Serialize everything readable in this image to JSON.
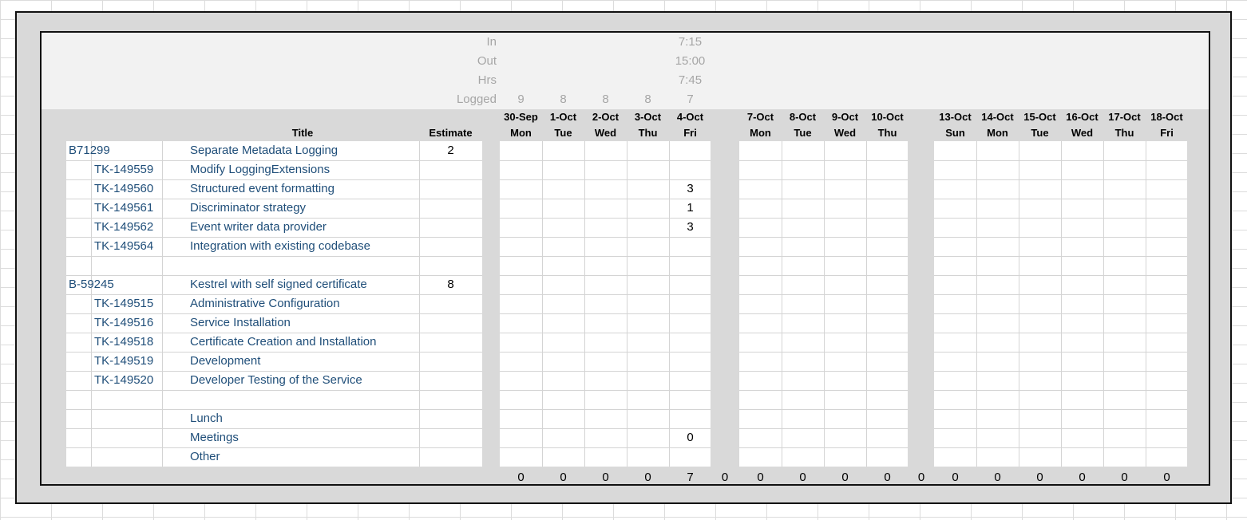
{
  "summary": {
    "labels": [
      "In",
      "Out",
      "Hrs",
      "Logged"
    ],
    "in": "7:15",
    "out": "15:00",
    "hrs": "7:45",
    "logged": [
      "9",
      "8",
      "8",
      "8",
      "7"
    ]
  },
  "headers": {
    "title": "Title",
    "estimate": "Estimate"
  },
  "weeks": [
    {
      "days": [
        {
          "date": "30-Sep",
          "dow": "Mon"
        },
        {
          "date": "1-Oct",
          "dow": "Tue"
        },
        {
          "date": "2-Oct",
          "dow": "Wed"
        },
        {
          "date": "3-Oct",
          "dow": "Thu"
        },
        {
          "date": "4-Oct",
          "dow": "Fri"
        }
      ]
    },
    {
      "days": [
        {
          "date": "7-Oct",
          "dow": "Mon"
        },
        {
          "date": "8-Oct",
          "dow": "Tue"
        },
        {
          "date": "9-Oct",
          "dow": "Wed"
        },
        {
          "date": "10-Oct",
          "dow": "Thu"
        }
      ]
    },
    {
      "days": [
        {
          "date": "13-Oct",
          "dow": "Sun"
        },
        {
          "date": "14-Oct",
          "dow": "Mon"
        },
        {
          "date": "15-Oct",
          "dow": "Tue"
        },
        {
          "date": "16-Oct",
          "dow": "Wed"
        },
        {
          "date": "17-Oct",
          "dow": "Thu"
        },
        {
          "date": "18-Oct",
          "dow": "Fri"
        }
      ]
    }
  ],
  "rows": [
    {
      "story": "B71299",
      "task": "",
      "title": "Separate Metadata Logging",
      "estimate": "2",
      "values": {}
    },
    {
      "story": "",
      "task": "TK-149559",
      "title": "Modify LoggingExtensions",
      "estimate": "",
      "values": {}
    },
    {
      "story": "",
      "task": "TK-149560",
      "title": "Structured event formatting",
      "estimate": "",
      "values": {
        "4": "3"
      }
    },
    {
      "story": "",
      "task": "TK-149561",
      "title": "Discriminator strategy",
      "estimate": "",
      "values": {
        "4": "1"
      }
    },
    {
      "story": "",
      "task": "TK-149562",
      "title": "Event writer data provider",
      "estimate": "",
      "values": {
        "4": "3"
      }
    },
    {
      "story": "",
      "task": "TK-149564",
      "title": "Integration with existing codebase",
      "estimate": "",
      "values": {}
    },
    {
      "story": "",
      "task": "",
      "title": "",
      "estimate": "",
      "values": {}
    },
    {
      "story": "B-59245",
      "task": "",
      "title": "Kestrel with self signed certificate",
      "estimate": "8",
      "values": {}
    },
    {
      "story": "",
      "task": "TK-149515",
      "title": "Administrative Configuration",
      "estimate": "",
      "values": {}
    },
    {
      "story": "",
      "task": "TK-149516",
      "title": "Service Installation",
      "estimate": "",
      "values": {}
    },
    {
      "story": "",
      "task": "TK-149518",
      "title": "Certificate Creation and Installation",
      "estimate": "",
      "values": {}
    },
    {
      "story": "",
      "task": "TK-149519",
      "title": "Development",
      "estimate": "",
      "values": {}
    },
    {
      "story": "",
      "task": "TK-149520",
      "title": "Developer Testing of the Service",
      "estimate": "",
      "values": {}
    },
    {
      "story": "",
      "task": "",
      "title": "",
      "estimate": "",
      "values": {}
    },
    {
      "story": "",
      "task": "",
      "title": "Lunch",
      "estimate": "",
      "values": {}
    },
    {
      "story": "",
      "task": "",
      "title": "Meetings",
      "estimate": "",
      "values": {
        "4": "0"
      }
    },
    {
      "story": "",
      "task": "",
      "title": "Other",
      "estimate": "",
      "values": {}
    }
  ],
  "totals": {
    "days": [
      "0",
      "0",
      "0",
      "0",
      "7",
      "0",
      "0",
      "0",
      "0",
      "0",
      "0",
      "0",
      "0",
      "0",
      "0"
    ],
    "week_totals": [
      "0",
      "0"
    ]
  }
}
